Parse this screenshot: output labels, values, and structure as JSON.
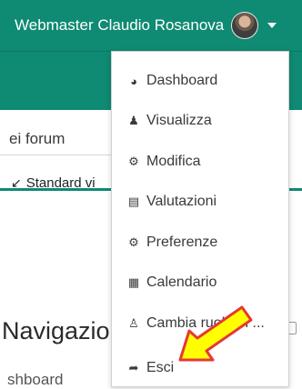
{
  "header": {
    "user_name": "Webmaster Claudio Rosanova",
    "colors": {
      "navbar": "#0f8a73",
      "accent": "#0f8a73"
    }
  },
  "background": {
    "search_fragment": "ei forum",
    "standard_view": "Standard vi",
    "nav_title": "Navigazio",
    "nav_item": "shboard"
  },
  "user_menu": {
    "items": [
      {
        "label": "Dashboard",
        "icon": "tachometer-icon"
      },
      {
        "label": "Visualizza",
        "icon": "user-icon"
      },
      {
        "label": "Modifica",
        "icon": "cog-icon"
      },
      {
        "label": "Valutazioni",
        "icon": "table-icon"
      },
      {
        "label": "Preferenze",
        "icon": "wrench-icon"
      },
      {
        "label": "Calendario",
        "icon": "calendar-icon"
      },
      {
        "label": "Cambia ruolo in ...",
        "icon": "user-outline-icon"
      },
      {
        "label": "Esci",
        "icon": "sign-out-icon"
      }
    ]
  },
  "annotation": {
    "arrow": "yellow-arrow",
    "color": "#ffff00",
    "outline": "#e53935"
  }
}
